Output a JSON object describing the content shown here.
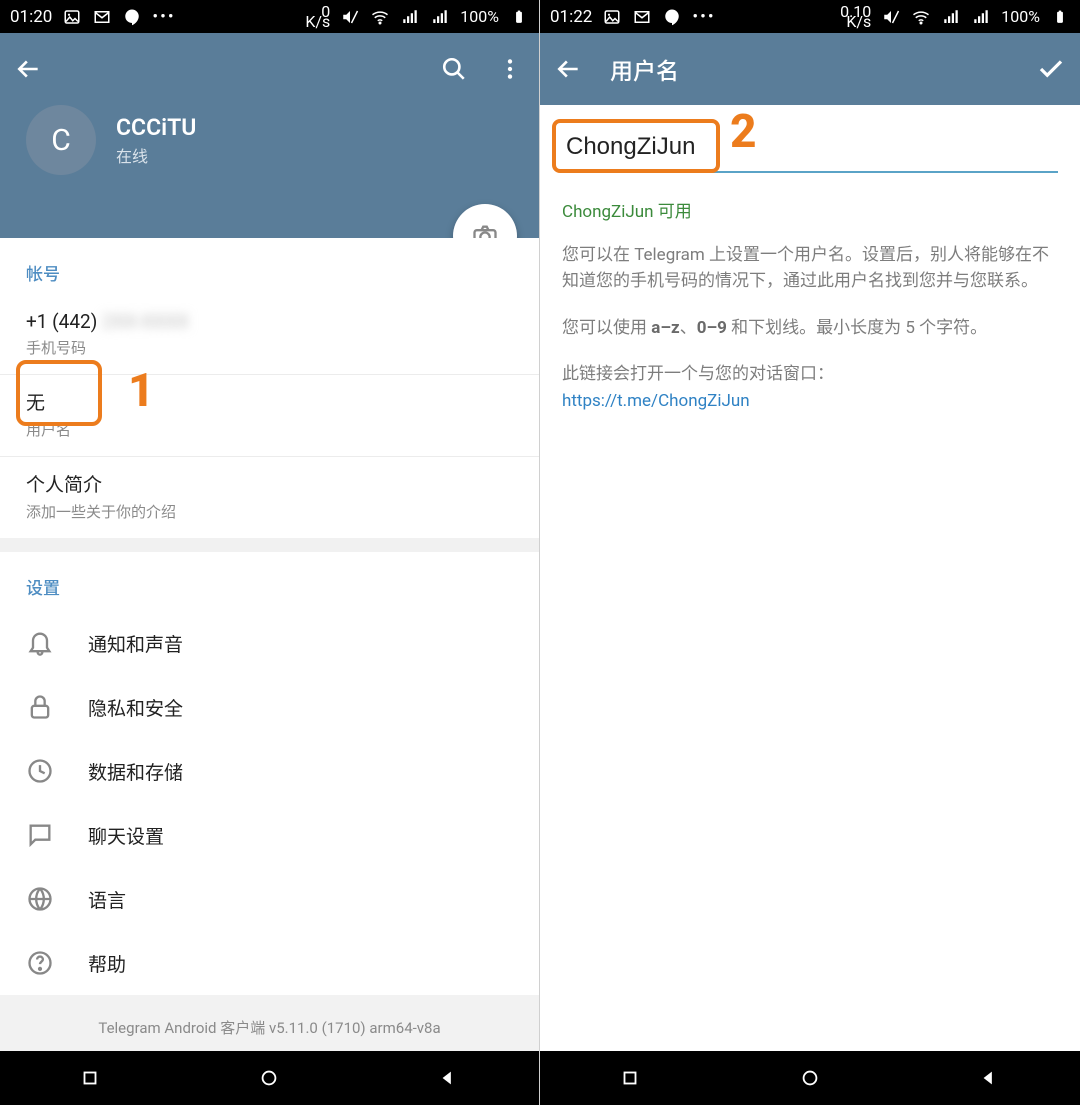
{
  "left": {
    "statusbar": {
      "time": "01:20",
      "speed_top": "0",
      "speed_bot": "K/s",
      "battery": "100%"
    },
    "profile": {
      "initial": "C",
      "name": "CCCiTU",
      "status": "在线"
    },
    "account": {
      "section": "帐号",
      "phone_prefix": "+1 (442)",
      "phone_blur": "2XX-XXXX",
      "phone_label": "手机号码",
      "username_value": "无",
      "username_label": "用户名",
      "bio_title": "个人简介",
      "bio_hint": "添加一些关于你的介绍"
    },
    "settings": {
      "section": "设置",
      "items": [
        {
          "label": "通知和声音",
          "icon": "bell"
        },
        {
          "label": "隐私和安全",
          "icon": "lock"
        },
        {
          "label": "数据和存储",
          "icon": "clock"
        },
        {
          "label": "聊天设置",
          "icon": "chat"
        },
        {
          "label": "语言",
          "icon": "globe"
        },
        {
          "label": "帮助",
          "icon": "help"
        }
      ]
    },
    "version": "Telegram Android 客户端 v5.11.0 (1710) arm64-v8a",
    "callout": "1"
  },
  "right": {
    "statusbar": {
      "time": "01:22",
      "speed_top": "0.10",
      "speed_bot": "K/s",
      "battery": "100%"
    },
    "appbar_title": "用户名",
    "input_value": "ChongZiJun",
    "availability": "ChongZiJun 可用",
    "explain1": "您可以在 Telegram 上设置一个用户名。设置后，别人将能够在不知道您的手机号码的情况下，通过此用户名找到您并与您联系。",
    "explain2a": "您可以使用 ",
    "explain2b1": "a–z",
    "explain2b2": "、",
    "explain2b3": "0–9",
    "explain2c": " 和下划线。最小长度为 5 个字符。",
    "explain3": "此链接会打开一个与您的对话窗口：",
    "link": "https://t.me/ChongZiJun",
    "callout": "2"
  }
}
